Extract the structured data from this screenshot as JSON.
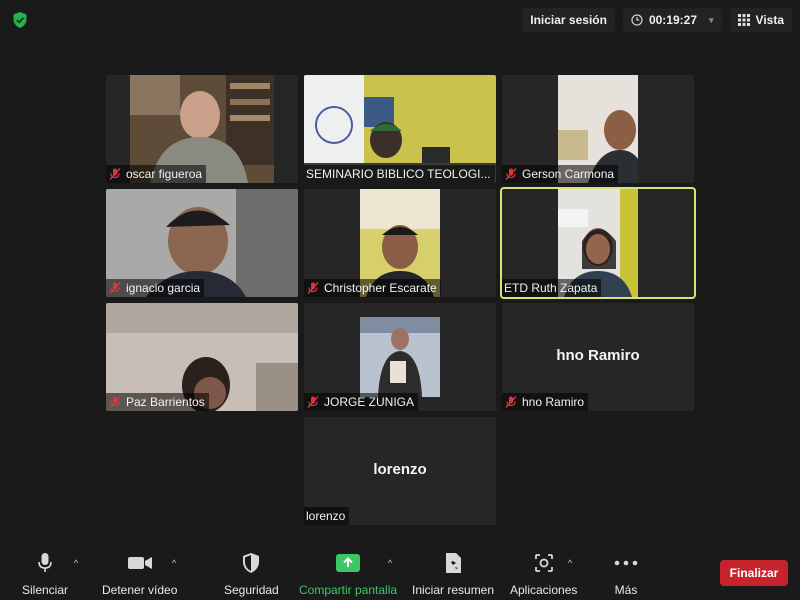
{
  "header": {
    "sign_in_label": "Iniciar sesión",
    "timer": "00:19:27",
    "view_label": "Vista"
  },
  "participants": [
    {
      "name": "oscar figueroa",
      "muted": true,
      "video": true
    },
    {
      "name": "SEMINARIO BIBLICO TEOLOGI...",
      "muted": false,
      "video": true
    },
    {
      "name": "Gerson Carmona",
      "muted": true,
      "video": true
    },
    {
      "name": "ignacio garcia",
      "muted": true,
      "video": true
    },
    {
      "name": "Christopher Escarate",
      "muted": true,
      "video": true
    },
    {
      "name": "ETD Ruth Zapata",
      "muted": false,
      "video": true,
      "active_speaker": true
    },
    {
      "name": "Paz Barrientos",
      "muted": true,
      "video": true
    },
    {
      "name": "JORGE ZUNIGA",
      "muted": true,
      "video": true
    },
    {
      "name": "hno Ramiro",
      "muted": true,
      "video": false,
      "display_name": "hno Ramiro"
    },
    {
      "name": "lorenzo",
      "muted": false,
      "video": false,
      "display_name": "lorenzo"
    }
  ],
  "toolbar": {
    "mute_label": "Silenciar",
    "video_label": "Detener vídeo",
    "security_label": "Seguridad",
    "share_label": "Compartir pantalla",
    "summary_label": "Iniciar resumen",
    "apps_label": "Aplicaciones",
    "more_label": "Más",
    "end_label": "Finalizar"
  },
  "colors": {
    "background": "#1a1a1a",
    "tile": "#262626",
    "active_border": "#d8e27a",
    "share_green": "#3cc766",
    "end_red": "#c7232c",
    "mute_red": "#e0343c"
  }
}
